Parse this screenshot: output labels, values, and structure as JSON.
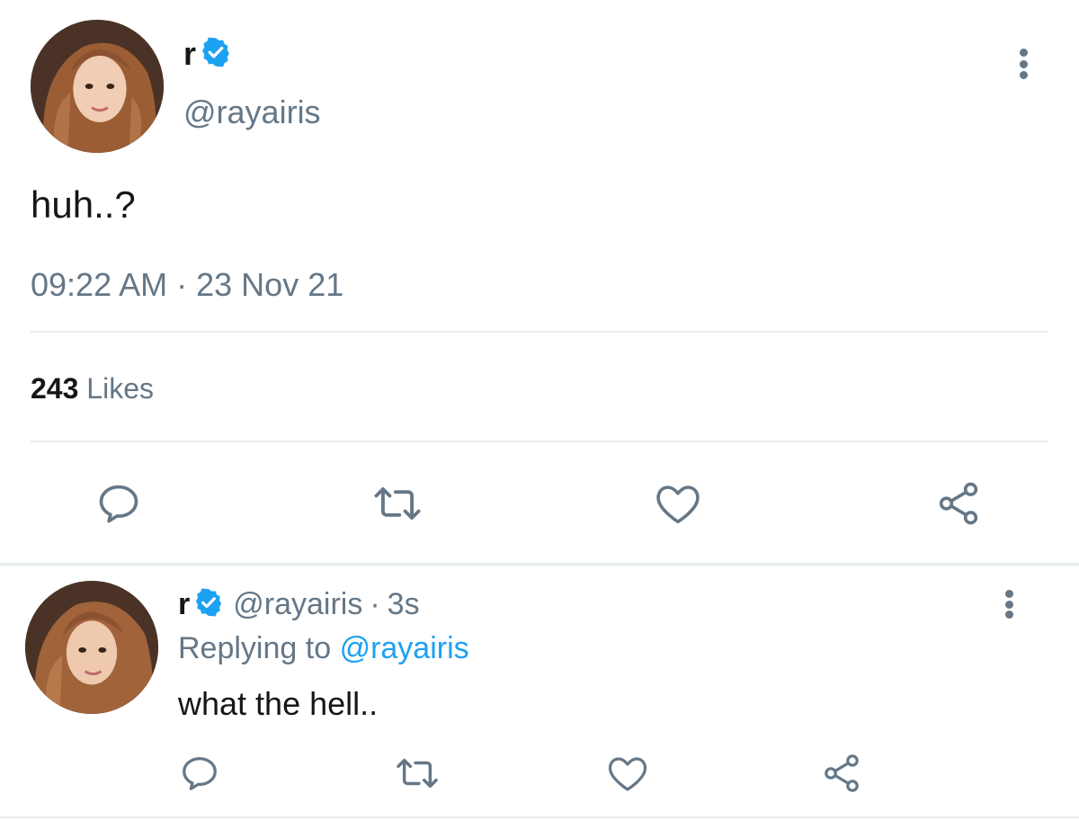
{
  "main_tweet": {
    "display_name": "r",
    "handle": "@rayairis",
    "text": "huh..?",
    "time": "09:22 AM",
    "separator": "·",
    "date": "23 Nov 21",
    "likes_count": "243",
    "likes_label": "Likes"
  },
  "reply_tweet": {
    "display_name": "r",
    "handle": "@rayairis",
    "separator": "·",
    "age": "3s",
    "replying_prefix": "Replying to",
    "replying_handle": "@rayairis",
    "text": "what the hell.."
  },
  "icons": {
    "reply": "reply-icon",
    "retweet": "retweet-icon",
    "like": "heart-icon",
    "share": "share-icon",
    "verified": "verified-badge-icon",
    "more": "more-vertical-icon"
  },
  "colors": {
    "verified_blue": "#1da1f2",
    "secondary_text": "#657786",
    "link_blue": "#1da1f2",
    "divider": "#e6ecf0"
  }
}
